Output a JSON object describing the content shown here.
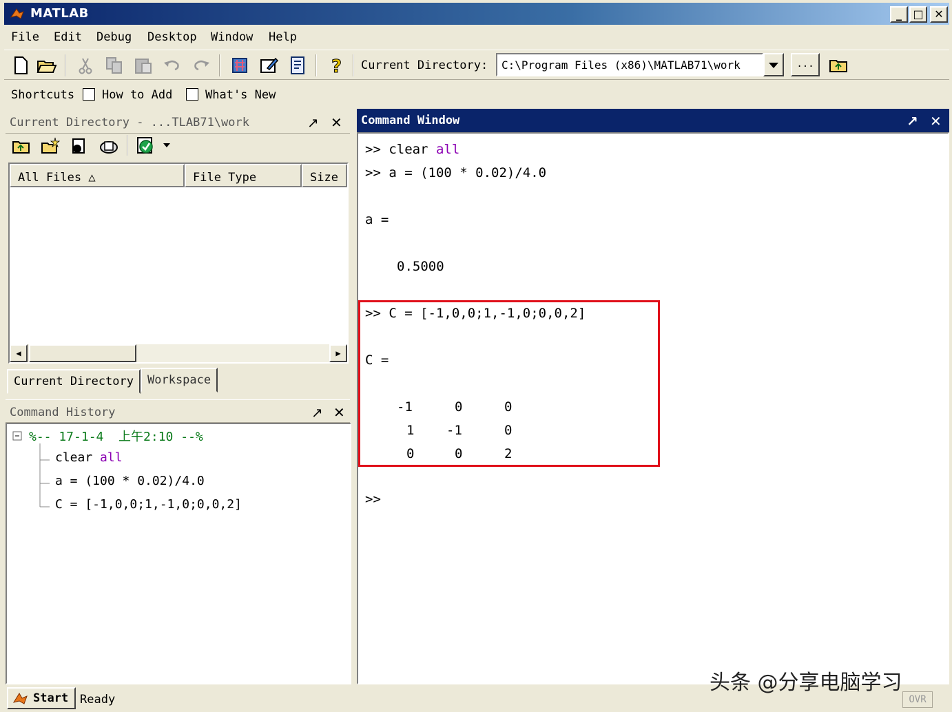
{
  "window": {
    "title": "MATLAB",
    "minimize_label": "_",
    "maximize_label": "□",
    "close_label": "✕"
  },
  "menu": [
    "File",
    "Edit",
    "Debug",
    "Desktop",
    "Window",
    "Help"
  ],
  "toolbar": {
    "current_directory_label": "Current Directory:",
    "current_directory_value": "C:\\Program Files (x86)\\MATLAB71\\work",
    "browse_label": "...",
    "icons": [
      "new-file-icon",
      "open-folder-icon",
      "cut-icon",
      "copy-icon",
      "paste-icon",
      "undo-icon",
      "redo-icon",
      "simulink-icon",
      "guide-icon",
      "profiler-icon",
      "help-icon",
      "parent-folder-icon"
    ]
  },
  "shortcuts": {
    "label": "Shortcuts",
    "items": [
      "How to Add",
      "What's New"
    ]
  },
  "current_directory_panel": {
    "title": "Current Directory - ...TLAB71\\work",
    "dock_label": "↗",
    "close_label": "✕",
    "columns": [
      "All Files △",
      "File Type",
      "Size"
    ],
    "files": [],
    "tabs": [
      "Current Directory",
      "Workspace"
    ]
  },
  "command_history": {
    "title": "Command History",
    "dock_label": "↗",
    "close_label": "✕",
    "session_header": "%-- 17-1-4  上午2:10 --%",
    "entries": [
      {
        "text": "clear ",
        "kw": "all"
      },
      {
        "text": "a = (100 * 0.02)/4.0",
        "kw": ""
      },
      {
        "text": "C = [-1,0,0;1,-1,0;0,0,2]",
        "kw": ""
      }
    ]
  },
  "command_window": {
    "title": "Command Window",
    "dock_label": "↗",
    "close_label": "✕",
    "lines": {
      "l1_prompt": ">> clear ",
      "l1_kw": "all",
      "l2": ">> a = (100 * 0.02)/4.0",
      "l3": "a =",
      "l4": "0.5000",
      "l5": ">> C = [-1,0,0;1,-1,0;0,0,2]",
      "l6": "C =",
      "matrix": [
        [
          "-1",
          "0",
          "0"
        ],
        [
          "1",
          "-1",
          "0"
        ],
        [
          "0",
          "0",
          "2"
        ]
      ],
      "prompt": ">>"
    },
    "highlight_color": "#e0101a"
  },
  "statusbar": {
    "start_label": "Start",
    "status": "Ready",
    "ovr": "OVR"
  },
  "watermark": "头条 @分享电脑学习"
}
